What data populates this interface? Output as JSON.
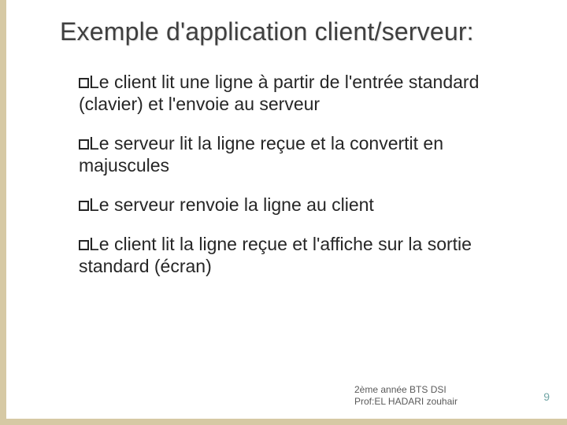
{
  "title": "Exemple d'application client/serveur:",
  "bullets": [
    "Le client lit une ligne à partir de l'entrée standard (clavier) et l'envoie au serveur",
    "Le serveur lit la ligne reçue et la convertit en majuscules",
    "Le serveur renvoie la ligne au client",
    "Le client lit la ligne reçue et l'affiche sur la sortie standard (écran)"
  ],
  "footer": {
    "line1": "2ème année BTS DSI",
    "line2": "Prof:EL HADARI zouhair"
  },
  "page_number": "9"
}
